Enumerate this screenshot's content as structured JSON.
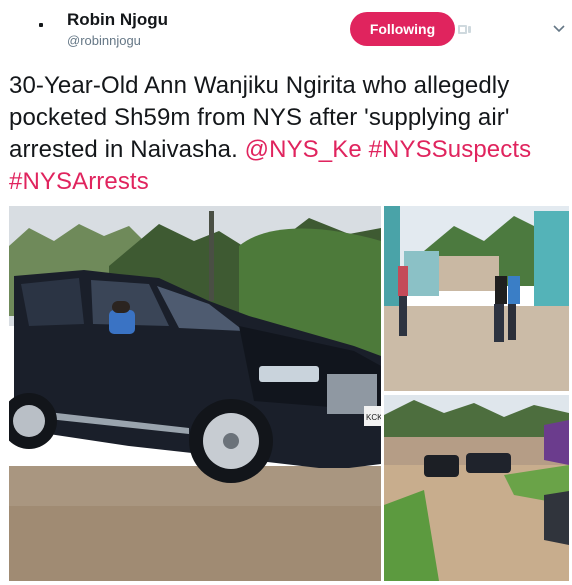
{
  "tweet_header": {
    "display_name": "Robin Njogu",
    "handle": "@robinnjogu",
    "follow_button_label": "Following",
    "notification_icon": "bell-icon",
    "menu_icon": "chevron-down-icon"
  },
  "tweet": {
    "text_plain": "30-Year-Old Ann Wanjiku Ngirita who allegedly pocketed Sh59m from NYS after 'supplying air' arrested in Naivasha.",
    "mention": "@NYS_Ke",
    "hashtag1": "#NYSSuspects",
    "hashtag2": "#NYSArrests"
  },
  "colors": {
    "accent": "#e0245e",
    "text": "#14171a",
    "secondary": "#657786"
  },
  "media": {
    "photo1_plate_text": "KCK"
  }
}
